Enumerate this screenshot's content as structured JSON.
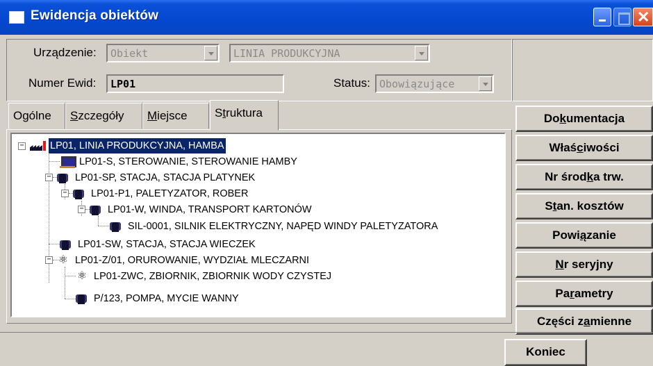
{
  "window": {
    "title": "Ewidencja obiektów"
  },
  "header": {
    "urzadzenie_label": "Urządzenie:",
    "urzadzenie_value": "Obiekt",
    "type_value": "LINIA PRODUKCYJNA",
    "numer_label": "Numer Ewid:",
    "numer_value": "LP01",
    "status_label": "Status:",
    "status_value": "Obowiązujące"
  },
  "tabs": [
    {
      "label_pre": "Ogólne",
      "u": "",
      "label_post": ""
    },
    {
      "label_pre": "",
      "u": "S",
      "label_post": "zczegóły"
    },
    {
      "label_pre": "",
      "u": "M",
      "label_post": "iejsce"
    },
    {
      "label_pre": "S",
      "u": "t",
      "label_post": "ruktura"
    }
  ],
  "tree": [
    {
      "text": "LP01, LINIA PRODUKCYJNA, HAMBA",
      "icon": "factory-icon"
    },
    {
      "text": "LP01-S, STEROWANIE, STEROWANIE HAMBY",
      "icon": "computer-icon"
    },
    {
      "text": "LP01-SP, STACJA, STACJA PLATYNEK",
      "icon": "motor-icon"
    },
    {
      "text": "LP01-P1, PALETYZATOR, ROBER",
      "icon": "motor-icon"
    },
    {
      "text": "LP01-W, WINDA, TRANSPORT KARTONÓW",
      "icon": "motor-icon"
    },
    {
      "text": "SIL-0001, SILNIK ELEKTRYCZNY, NAPĘD WINDY PALETYZATORA",
      "icon": "motor-icon"
    },
    {
      "text": "LP01-SW, STACJA, STACJA WIECZEK",
      "icon": "motor-icon"
    },
    {
      "text": "LP01-Z/01, ORUROWANIE, WYDZIAŁ MLECZARNI",
      "icon": "pipe-icon"
    },
    {
      "text": "LP01-ZWC, ZBIORNIK, ZBIORNIK WODY CZYSTEJ",
      "icon": "pipe-icon"
    },
    {
      "text": "P/123, POMPA, MYCIE WANNY",
      "icon": "motor-icon"
    }
  ],
  "buttons": [
    {
      "pre": "Do",
      "u": "k",
      "post": "umentacja"
    },
    {
      "pre": "Właś",
      "u": "c",
      "post": "iwości"
    },
    {
      "pre": "Nr środ",
      "u": "k",
      "post": "a trw."
    },
    {
      "pre": "S",
      "u": "t",
      "post": "an. kosztów"
    },
    {
      "pre": "Powi",
      "u": "ą",
      "post": "zanie"
    },
    {
      "pre": "",
      "u": "N",
      "post": "r seryjny"
    },
    {
      "pre": "Pa",
      "u": "r",
      "post": "ametry"
    },
    {
      "pre": "Części z",
      "u": "a",
      "post": "mienne"
    }
  ],
  "koniec": "Koniec"
}
